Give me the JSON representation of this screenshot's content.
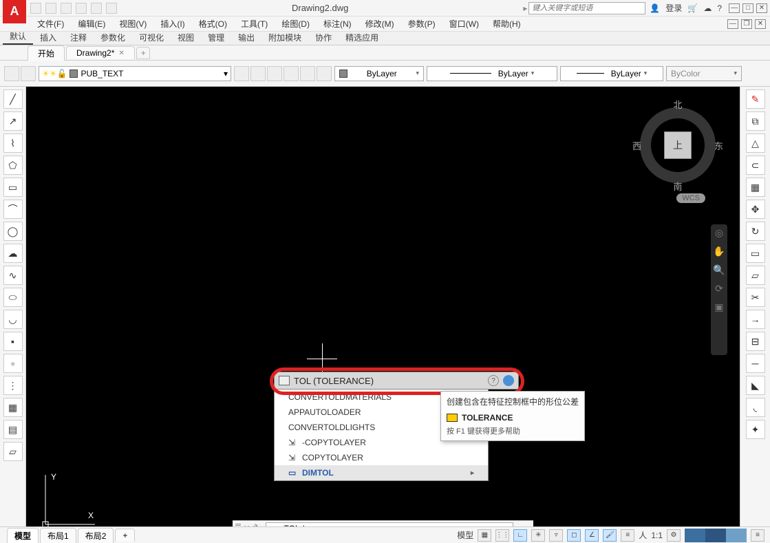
{
  "title": "Drawing2.dwg",
  "search_placeholder": "键入关键字或短语",
  "login_label": "登录",
  "menus": [
    "文件(F)",
    "编辑(E)",
    "视图(V)",
    "插入(I)",
    "格式(O)",
    "工具(T)",
    "绘图(D)",
    "标注(N)",
    "修改(M)",
    "参数(P)",
    "窗口(W)",
    "帮助(H)"
  ],
  "ribbon_tabs": [
    "默认",
    "插入",
    "注释",
    "参数化",
    "可视化",
    "视图",
    "管理",
    "输出",
    "附加模块",
    "协作",
    "精选应用"
  ],
  "doc_tabs": {
    "start": "开始",
    "active": "Drawing2*"
  },
  "layer_name": "PUB_TEXT",
  "combos": {
    "color": "ByLayer",
    "linetype": "ByLayer",
    "lineweight": "ByLayer",
    "plotstyle": "ByColor"
  },
  "viewcube": {
    "top": "上",
    "n": "北",
    "s": "南",
    "e": "东",
    "w": "西",
    "wcs": "WCS"
  },
  "ucs": {
    "x": "X",
    "y": "Y"
  },
  "autocomplete": {
    "main": "TOL (TOLERANCE)",
    "items": [
      "CONVERTOLDMATERIALS",
      "APPAUTOLOADER",
      "CONVERTOLDLIGHTS",
      "-COPYTOLAYER",
      "COPYTOLAYER"
    ],
    "dimtol": "DIMTOL"
  },
  "tooltip": {
    "line1": "创建包含在特征控制框中的形位公差",
    "title": "TOLERANCE",
    "help": "按 F1 键获得更多帮助"
  },
  "cmdline_value": "TOL",
  "layout_tabs": {
    "model": "模型",
    "l1": "布局1",
    "l2": "布局2"
  },
  "status": {
    "model": "模型",
    "scale": "1:1"
  }
}
